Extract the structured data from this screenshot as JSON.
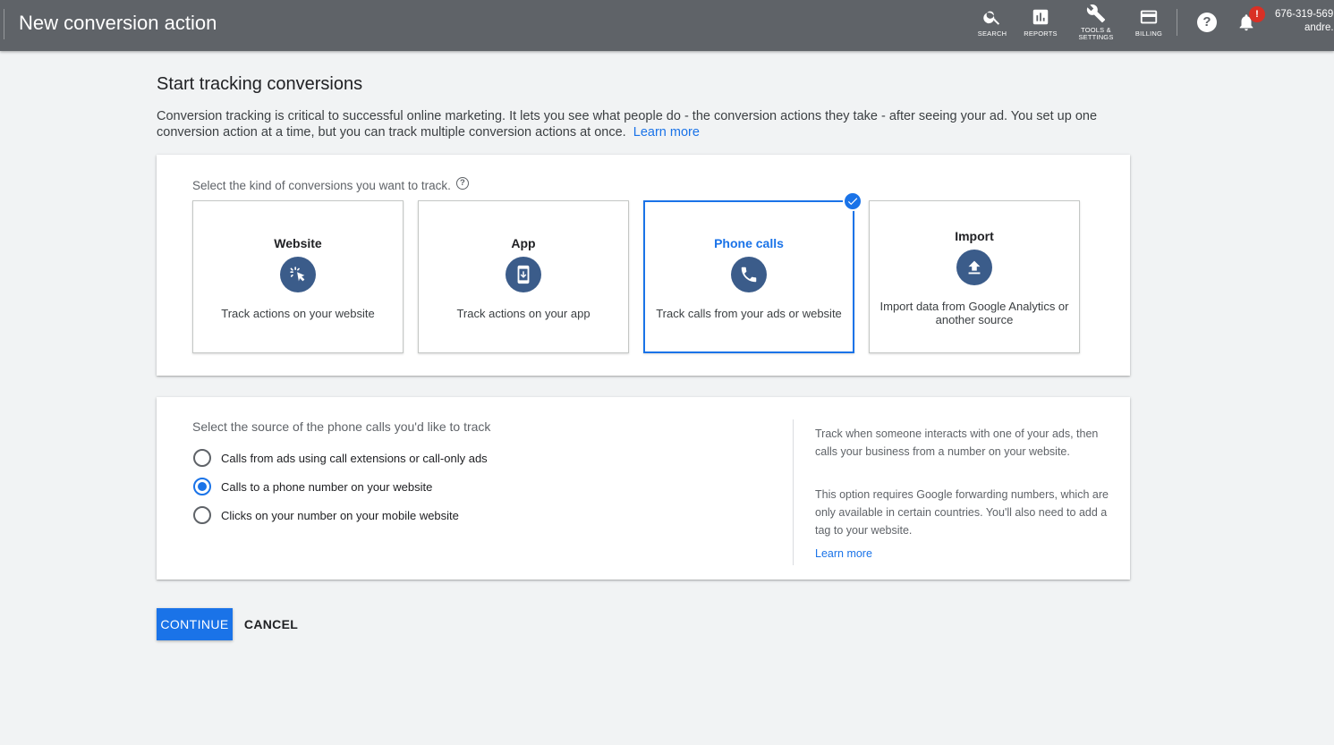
{
  "header": {
    "title": "New conversion action",
    "nav": [
      {
        "id": "search",
        "label": "SEARCH",
        "icon": "search-icon"
      },
      {
        "id": "reports",
        "label": "REPORTS",
        "icon": "reports-icon"
      },
      {
        "id": "tools",
        "label": "TOOLS &\nSETTINGS",
        "icon": "wrench-icon"
      },
      {
        "id": "billing",
        "label": "BILLING",
        "icon": "credit-card-icon"
      }
    ],
    "help": "?",
    "notification_badge": "!",
    "account_id": "676-319-569",
    "account_name": "andre."
  },
  "page": {
    "heading": "Start tracking conversions",
    "intro": "Conversion tracking is critical to successful online marketing. It lets you see what people do - the conversion actions they take - after seeing your ad. You set up one conversion action at a time, but you can track multiple conversion actions at once.",
    "intro_link": "Learn more"
  },
  "kinds": {
    "prompt": "Select the kind of conversions you want to track.",
    "help_glyph": "?",
    "options": [
      {
        "title": "Website",
        "desc": "Track actions on your website",
        "icon": "cursor-click-icon",
        "selected": false
      },
      {
        "title": "App",
        "desc": "Track actions on your app",
        "icon": "phone-download-icon",
        "selected": false
      },
      {
        "title": "Phone calls",
        "desc": "Track calls from your ads or website",
        "icon": "phone-icon",
        "selected": true
      },
      {
        "title": "Import",
        "desc": "Import data from Google Analytics or another source",
        "icon": "upload-icon",
        "selected": false
      }
    ]
  },
  "source": {
    "prompt": "Select the source of the phone calls you'd like to track",
    "options": [
      {
        "label": "Calls from ads using call extensions or call-only ads",
        "selected": false
      },
      {
        "label": "Calls to a phone number on your website",
        "selected": true
      },
      {
        "label": "Clicks on your number on your mobile website",
        "selected": false
      }
    ],
    "info_p1": "Track when someone interacts with one of your ads, then calls your business from a number on your website.",
    "info_p2": "This option requires Google forwarding numbers, which are only available in certain countries. You'll also need to add a tag to your website.",
    "info_link": "Learn more"
  },
  "actions": {
    "continue": "CONTINUE",
    "cancel": "CANCEL"
  },
  "colors": {
    "header_bg": "#5f6368",
    "accent": "#1a73e8",
    "icon_circle": "#3b5c8a",
    "badge": "#d93025"
  }
}
